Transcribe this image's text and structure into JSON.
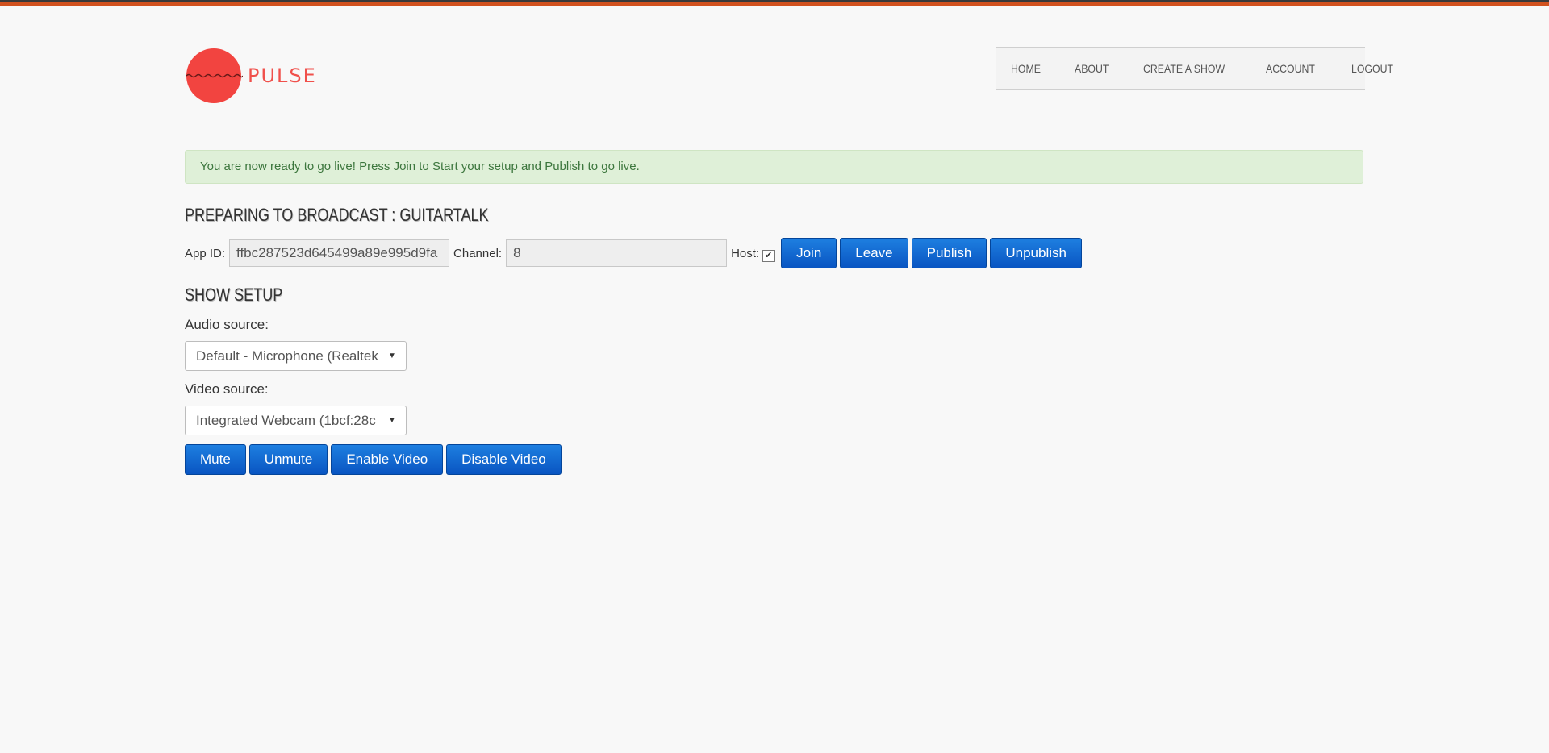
{
  "brand": {
    "name": "PULSE",
    "color": "#f0504b"
  },
  "nav": {
    "items": [
      "HOME",
      "ABOUT",
      "CREATE A SHOW",
      "ACCOUNT",
      "LOGOUT"
    ]
  },
  "alert": {
    "text": "You are now ready to go live! Press Join to Start your setup and Publish to go live."
  },
  "broadcast": {
    "title": "PREPARING TO BROADCAST : GUITARTALK",
    "app_id_label": "App ID:",
    "app_id_value": "ffbc287523d645499a89e995d9fa",
    "channel_label": "Channel:",
    "channel_value": "8",
    "host_label": "Host:",
    "host_checked": true,
    "buttons": {
      "join": "Join",
      "leave": "Leave",
      "publish": "Publish",
      "unpublish": "Unpublish"
    }
  },
  "setup": {
    "title": "SHOW SETUP",
    "audio_label": "Audio source:",
    "audio_value": "Default - Microphone (Realtek",
    "video_label": "Video source:",
    "video_value": "Integrated Webcam (1bcf:28c",
    "buttons": {
      "mute": "Mute",
      "unmute": "Unmute",
      "enable_video": "Enable Video",
      "disable_video": "Disable Video"
    }
  },
  "colors": {
    "accent_stripe": "#d2521f",
    "button": "#0955c2",
    "alert_bg": "#dff0d8"
  }
}
